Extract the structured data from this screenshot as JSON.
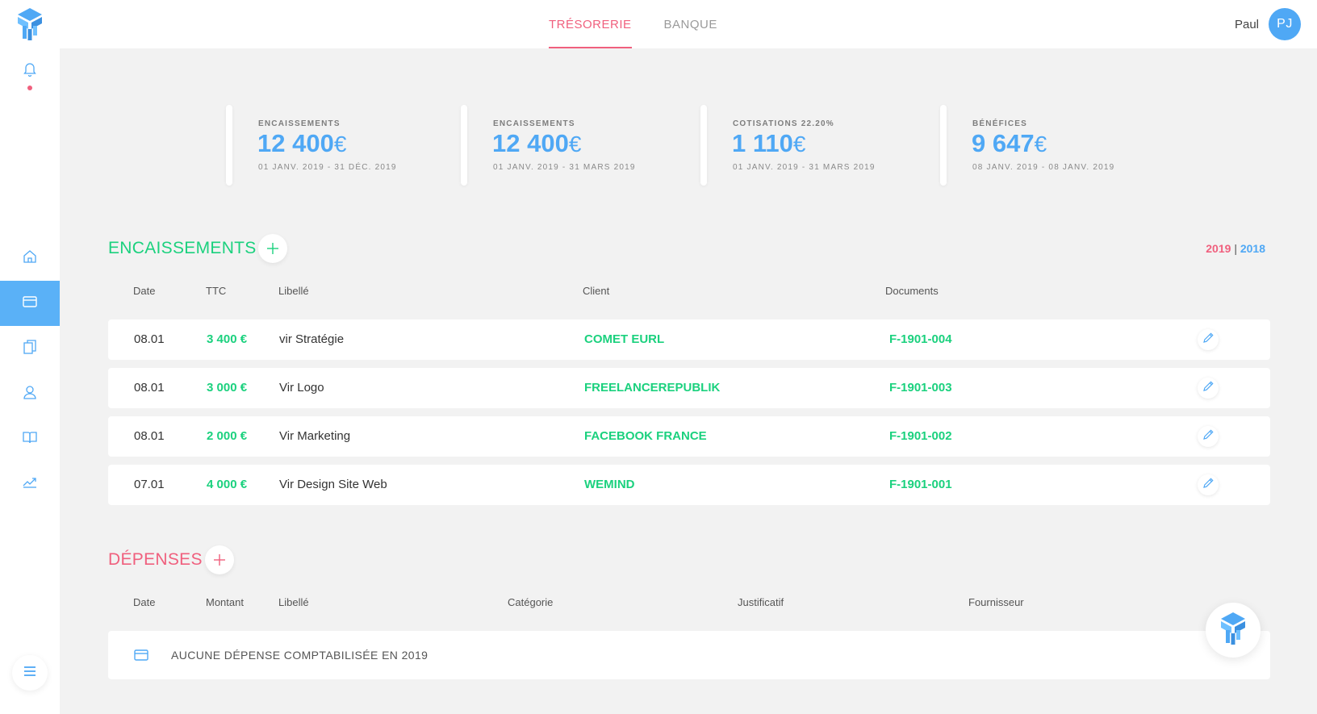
{
  "header": {
    "tabs": [
      {
        "label": "TRÉSORERIE",
        "active": true
      },
      {
        "label": "BANQUE",
        "active": false
      }
    ],
    "user": {
      "name": "Paul",
      "initials": "PJ"
    }
  },
  "sidebar": {
    "icons": [
      "logo-icon",
      "bell-icon",
      "home-icon",
      "card-icon",
      "documents-icon",
      "user-icon",
      "book-icon",
      "trend-icon",
      "menu-icon"
    ],
    "active": "card-icon"
  },
  "kpis": [
    {
      "label": "ENCAISSEMENTS",
      "value": "12 400",
      "currency": "€",
      "period": "01 JANV. 2019 - 31 DÉC. 2019"
    },
    {
      "label": "ENCAISSEMENTS",
      "value": "12 400",
      "currency": "€",
      "period": "01 JANV. 2019 - 31 MARS 2019"
    },
    {
      "label": "COTISATIONS 22.20%",
      "value": "1 110",
      "currency": "€",
      "period": "01 JANV. 2019 - 31 MARS 2019"
    },
    {
      "label": "BÉNÉFICES",
      "value": "9 647",
      "currency": "€",
      "period": "08 JANV. 2019 - 08 JANV. 2019"
    }
  ],
  "encaissements": {
    "title": "ENCAISSEMENTS",
    "years": {
      "current": "2019",
      "separator": "|",
      "previous": "2018"
    },
    "columns": {
      "date": "Date",
      "ttc": "TTC",
      "libelle": "Libellé",
      "client": "Client",
      "documents": "Documents"
    },
    "rows": [
      {
        "date": "08.01",
        "ttc": "3 400 €",
        "libelle": "vir Stratégie",
        "client": "COMET EURL",
        "document": "F-1901-004"
      },
      {
        "date": "08.01",
        "ttc": "3 000 €",
        "libelle": "Vir Logo",
        "client": "FREELANCEREPUBLIK",
        "document": "F-1901-003"
      },
      {
        "date": "08.01",
        "ttc": "2 000 €",
        "libelle": "Vir Marketing",
        "client": "FACEBOOK FRANCE",
        "document": "F-1901-002"
      },
      {
        "date": "07.01",
        "ttc": "4 000 €",
        "libelle": "Vir Design Site Web",
        "client": "WEMIND",
        "document": "F-1901-001"
      }
    ]
  },
  "depenses": {
    "title": "DÉPENSES",
    "columns": {
      "date": "Date",
      "montant": "Montant",
      "libelle": "Libellé",
      "categorie": "Catégorie",
      "justificatif": "Justificatif",
      "fournisseur": "Fournisseur"
    },
    "empty_message": "AUCUNE DÉPENSE COMPTABILISÉE EN 2019"
  },
  "colors": {
    "accent_blue": "#4fa8f5",
    "accent_pink": "#f0607e",
    "accent_green": "#1bd17e"
  }
}
